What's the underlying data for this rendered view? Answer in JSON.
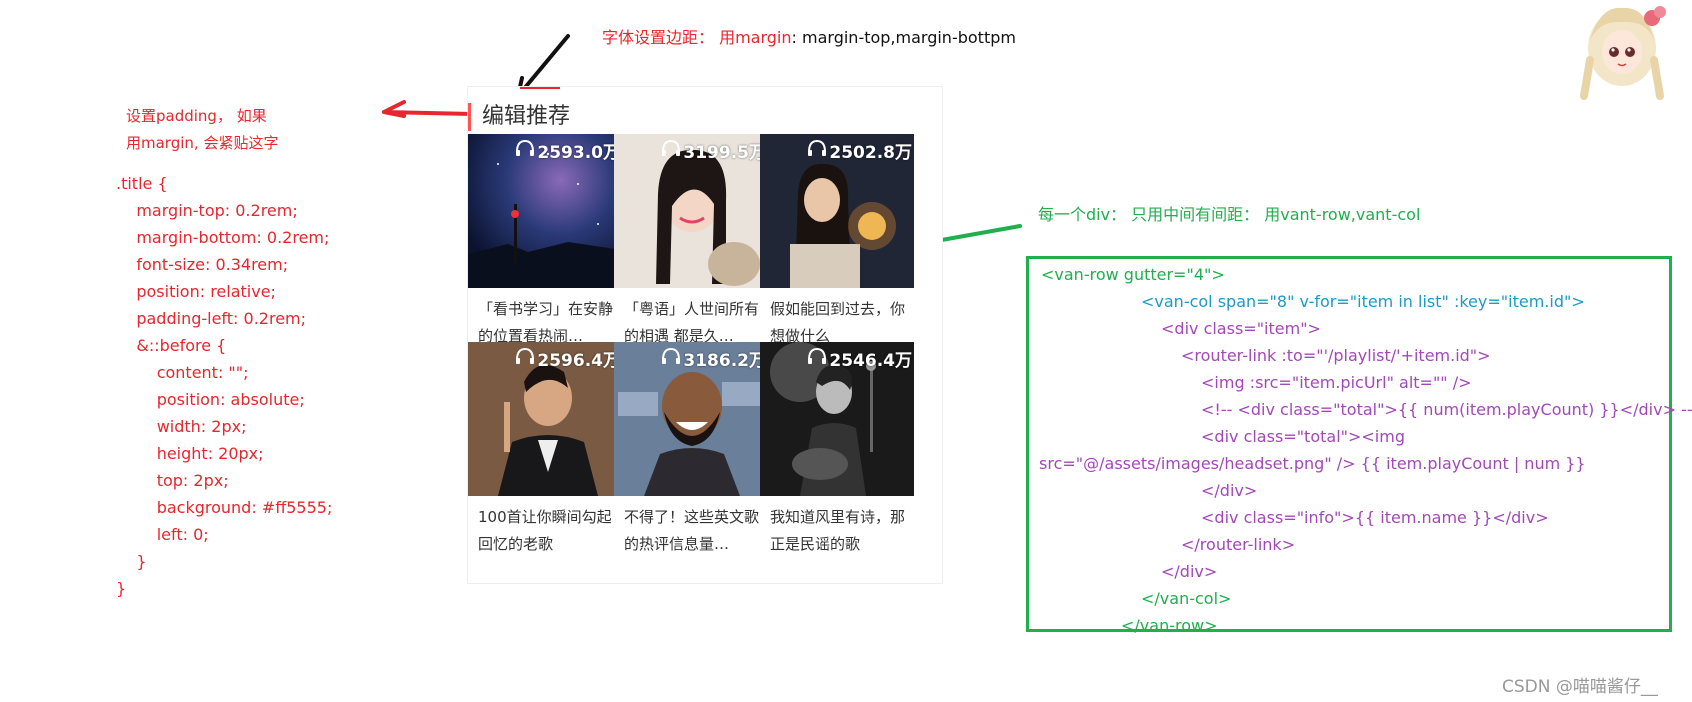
{
  "top_note": {
    "red_part": "字体设置边距：  用margin",
    "black_part": ": margin-top,margin-bottpm"
  },
  "left_note": {
    "line1": "设置padding，  如果",
    "line2": "用margin, 会紧贴这字"
  },
  "css_code": [
    ".title {",
    "    margin-top: 0.2rem;",
    "    margin-bottom: 0.2rem;",
    "    font-size: 0.34rem;",
    "    position: relative;",
    "    padding-left: 0.2rem;",
    "",
    "    &::before {",
    "        content: \"\";",
    "        position: absolute;",
    "        width: 2px;",
    "        height: 20px;",
    "        top: 2px;",
    "        background: #ff5555;",
    "        left: 0;",
    "    }",
    "}"
  ],
  "green_note": "每一个div：  只用中间有间距：  用vant-row,vant-col",
  "template_code": [
    "<van-row gutter=\"4\">",
    "<van-col span=\"8\" v-for=\"item in list\" :key=\"item.id\">",
    "<div class=\"item\">",
    "<router-link :to=\"'/playlist/'+item.id\">",
    "<img :src=\"item.picUrl\" alt=\"\" />",
    "<!-- <div class=\"total\">{{ num(item.playCount) }}</div> -->",
    "<div class=\"total\"><img",
    "src=\"@/assets/images/headset.png\" /> {{ item.playCount | num }}",
    "</div>",
    "<div class=\"info\">{{ item.name }}</div>",
    "</router-link>",
    "</div>",
    "</van-col>",
    "</van-row>"
  ],
  "phone": {
    "title": "编辑推荐",
    "playlists": [
      {
        "count": "2593.0万",
        "name": "「看书学习」在安静的位置看热闹…",
        "theme": "starry-night"
      },
      {
        "count": "3199.5万",
        "name": "「粤语」人世间所有的相遇 都是久…",
        "theme": "girl-portrait"
      },
      {
        "count": "2502.8万",
        "name": "假如能回到过去，你想做什么",
        "theme": "sparkler-girl"
      },
      {
        "count": "2596.4万",
        "name": "100首让你瞬间勾起回忆的老歌",
        "theme": "man-suit"
      },
      {
        "count": "3186.2万",
        "name": "不得了！这些英文歌的热评信息量…",
        "theme": "laughing-man"
      },
      {
        "count": "2546.4万",
        "name": "我知道风里有诗，那正是民谣的歌",
        "theme": "guitar-singer"
      }
    ]
  },
  "watermark": "CSDN @喵喵酱仔__",
  "colors": {
    "annotation_red": "#e8262d",
    "annotation_green": "#1fb04c",
    "title_bar": "#ff5555",
    "code_purple": "#a348b8",
    "code_cyan": "#1a9bc8"
  }
}
